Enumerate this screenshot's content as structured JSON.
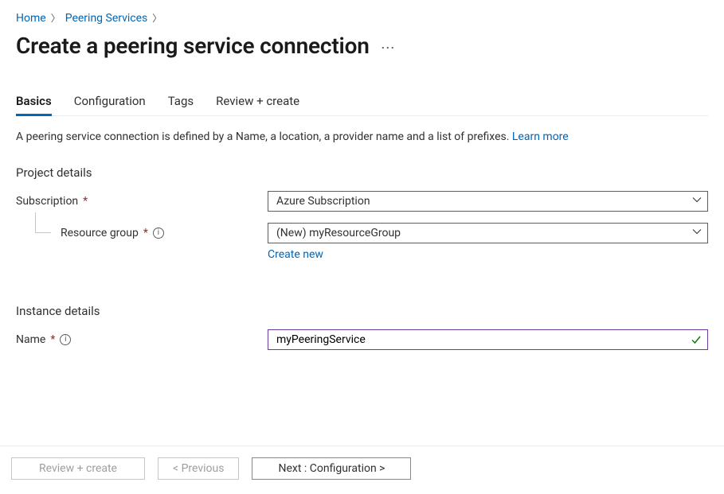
{
  "breadcrumb": {
    "home": "Home",
    "peering_services": "Peering Services"
  },
  "page_title": "Create a peering service connection",
  "tabs": {
    "basics": "Basics",
    "configuration": "Configuration",
    "tags": "Tags",
    "review_create": "Review + create"
  },
  "intro": {
    "text": "A peering service connection is defined by a Name, a location, a provider name and a list of prefixes. ",
    "learn_more": "Learn more"
  },
  "sections": {
    "project_details": "Project details",
    "instance_details": "Instance details"
  },
  "fields": {
    "subscription": {
      "label": "Subscription",
      "value": "Azure Subscription"
    },
    "resource_group": {
      "label": "Resource group",
      "value": "(New) myResourceGroup",
      "create_new": "Create new"
    },
    "name": {
      "label": "Name",
      "value": "myPeeringService"
    }
  },
  "footer": {
    "review_create": "Review + create",
    "previous": "< Previous",
    "next": "Next : Configuration >"
  }
}
